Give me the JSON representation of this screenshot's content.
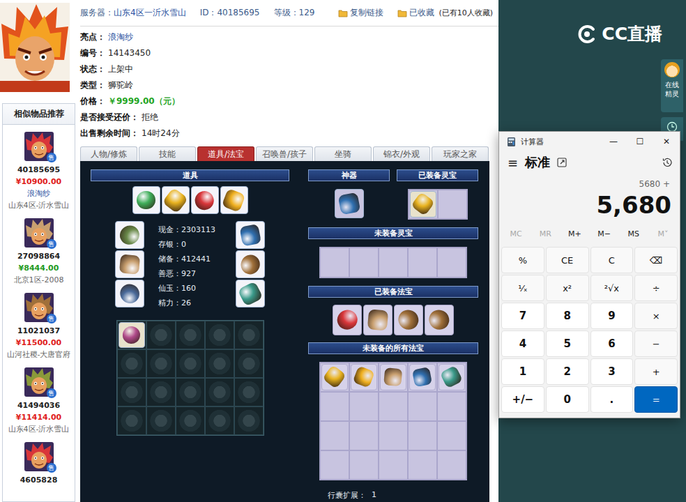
{
  "header": {
    "server_label": "服务器：",
    "server": "山东4区一沂水雪山",
    "id_label": "ID：",
    "id": "40185695",
    "level_label": "等级：",
    "level": "129",
    "copy": "复制链接",
    "saved": "已收藏",
    "saved_count": "(已有10人收藏)"
  },
  "info": [
    {
      "label": "亮点：",
      "value": "浪淘纱",
      "kind": "link"
    },
    {
      "label": "编号：",
      "value": "14143450",
      "kind": "plain"
    },
    {
      "label": "状态：",
      "value": "上架中",
      "kind": "plain"
    },
    {
      "label": "类型：",
      "value": "狮驼岭",
      "kind": "plain"
    },
    {
      "label": "价格：",
      "value": "￥9999.00（元）",
      "kind": "price"
    },
    {
      "label": "是否接受还价：",
      "value": "拒绝",
      "kind": "plain"
    },
    {
      "label": "出售剩余时间：",
      "value": "14时24分",
      "kind": "plain"
    }
  ],
  "tabs": [
    {
      "label": "人物/修炼",
      "selected": false
    },
    {
      "label": "技能",
      "selected": false
    },
    {
      "label": "道具/法宝",
      "selected": true
    },
    {
      "label": "召唤兽/孩子",
      "selected": false
    },
    {
      "label": "坐骑",
      "selected": false
    },
    {
      "label": "锦衣/外观",
      "selected": false
    },
    {
      "label": "玩家之家",
      "selected": false
    }
  ],
  "panel": {
    "props_title": "道具",
    "stats": [
      {
        "label": "现金：",
        "value": "2303113"
      },
      {
        "label": "存银：",
        "value": "0"
      },
      {
        "label": "储备：",
        "value": "412441"
      },
      {
        "label": "善恶：",
        "value": "927"
      },
      {
        "label": "仙玉：",
        "value": "160"
      },
      {
        "label": "精力：",
        "value": "26"
      }
    ],
    "inventory": [
      {
        "filled": true
      },
      {
        "filled": false
      },
      {
        "filled": false
      },
      {
        "filled": false
      },
      {
        "filled": false
      },
      {
        "filled": false
      },
      {
        "filled": false
      },
      {
        "filled": false
      },
      {
        "filled": false
      },
      {
        "filled": false
      },
      {
        "filled": false
      },
      {
        "filled": false
      },
      {
        "filled": false
      },
      {
        "filled": false
      },
      {
        "filled": false
      },
      {
        "filled": false
      },
      {
        "filled": false
      },
      {
        "filled": false
      },
      {
        "filled": false
      },
      {
        "filled": false
      }
    ],
    "artifact_title": "神器",
    "equipped_spirit_title": "已装备灵宝",
    "equipped_spirit_slots": [
      {
        "filled": true
      },
      {
        "filled": false
      }
    ],
    "unequipped_spirit_title": "未装备灵宝",
    "unequipped_spirit_slots": [
      {
        "filled": false
      },
      {
        "filled": false
      },
      {
        "filled": false
      },
      {
        "filled": false
      },
      {
        "filled": false
      }
    ],
    "equipped_treasure_title": "已装备法宝",
    "unequipped_treasure_title": "未装备的所有法宝",
    "unequipped_treasure_slots": [
      {
        "filled": true
      },
      {
        "filled": true
      },
      {
        "filled": true
      },
      {
        "filled": true
      },
      {
        "filled": true
      },
      {
        "filled": false
      },
      {
        "filled": false
      },
      {
        "filled": false
      },
      {
        "filled": false
      },
      {
        "filled": false
      },
      {
        "filled": false
      },
      {
        "filled": false
      },
      {
        "filled": false
      },
      {
        "filled": false
      },
      {
        "filled": false
      },
      {
        "filled": false
      },
      {
        "filled": false
      },
      {
        "filled": false
      },
      {
        "filled": false
      },
      {
        "filled": false
      }
    ],
    "expand_label": "行囊扩展：",
    "expand_value": "1"
  },
  "sidebar": {
    "title": "相似物品推荐",
    "badge": "售",
    "items": [
      {
        "id": "40185695",
        "price": "¥10900.00",
        "color": "#e0201c",
        "tag": "浪淘纱",
        "server": "山东4区-沂水雪山"
      },
      {
        "id": "27098864",
        "price": "¥8444.00",
        "color": "#1f9a1f",
        "server": "北京1区-2008"
      },
      {
        "id": "11021037",
        "price": "¥11500.00",
        "color": "#e0201c",
        "server": "山河社稷-大唐官府"
      },
      {
        "id": "41494036",
        "price": "¥11414.00",
        "color": "#e0201c",
        "server": "山东4区-沂水雪山"
      },
      {
        "id": "4605828"
      }
    ]
  },
  "stream": {
    "logo": "CC直播",
    "widget": "在线精灵"
  },
  "calculator": {
    "title": "计算器",
    "controls": [
      "—",
      "☐",
      "✕"
    ],
    "menu": "≡",
    "mode": "标准",
    "expression": "5680 +",
    "display": "5,680",
    "memory": [
      {
        "label": "MC",
        "disabled": true
      },
      {
        "label": "MR",
        "disabled": true
      },
      {
        "label": "M+",
        "disabled": false
      },
      {
        "label": "M−",
        "disabled": false
      },
      {
        "label": "MS",
        "disabled": false
      },
      {
        "label": "M˅",
        "disabled": true
      }
    ],
    "keys": [
      {
        "label": "%",
        "kind": "op"
      },
      {
        "label": "CE",
        "kind": "op"
      },
      {
        "label": "C",
        "kind": "op"
      },
      {
        "label": "⌫",
        "kind": "op"
      },
      {
        "label": "¹⁄ₓ",
        "kind": "op"
      },
      {
        "label": "x²",
        "kind": "op"
      },
      {
        "label": "²√x",
        "kind": "op"
      },
      {
        "label": "÷",
        "kind": "op"
      },
      {
        "label": "7",
        "kind": "digit"
      },
      {
        "label": "8",
        "kind": "digit"
      },
      {
        "label": "9",
        "kind": "digit"
      },
      {
        "label": "×",
        "kind": "op"
      },
      {
        "label": "4",
        "kind": "digit"
      },
      {
        "label": "5",
        "kind": "digit"
      },
      {
        "label": "6",
        "kind": "digit"
      },
      {
        "label": "−",
        "kind": "op"
      },
      {
        "label": "1",
        "kind": "digit"
      },
      {
        "label": "2",
        "kind": "digit"
      },
      {
        "label": "3",
        "kind": "digit"
      },
      {
        "label": "+",
        "kind": "op"
      },
      {
        "label": "+/−",
        "kind": "digit"
      },
      {
        "label": "0",
        "kind": "digit"
      },
      {
        "label": ".",
        "kind": "digit"
      },
      {
        "label": "=",
        "kind": "equals"
      }
    ]
  }
}
